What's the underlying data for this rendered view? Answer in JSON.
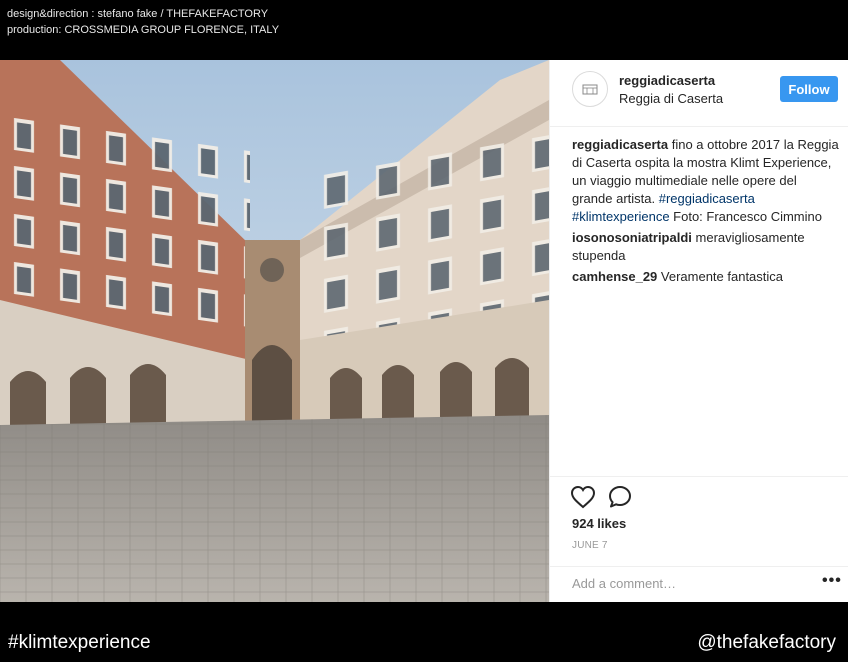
{
  "credits": {
    "line1": "design&direction : stefano fake / THEFAKEFACTORY",
    "line2": "production: CROSSMEDIA GROUP FLORENCE, ITALY"
  },
  "post": {
    "username": "reggiadicaserta",
    "location": "Reggia di Caserta",
    "follow_label": "Follow",
    "caption": {
      "user": "reggiadicaserta",
      "text": " fino a ottobre 2017 la Reggia di Caserta ospita la mostra Klimt Experience, un viaggio multimediale nelle opere del grande artista. ",
      "tag1": "#reggiadicaserta",
      "tag2": "#klimtexperience",
      "text2": " Foto: Francesco Cimmino"
    },
    "comments": [
      {
        "user": "iosonosoniatripaldi",
        "text": " meravigliosamente stupenda"
      },
      {
        "user": "camhense_29",
        "text": " Veramente fantastica"
      }
    ],
    "likes": "924 likes",
    "date": "JUNE 7",
    "add_comment_placeholder": "Add a comment…",
    "more_label": "•••"
  },
  "footer": {
    "left": "#klimtexperience",
    "right": "@thefakefactory"
  },
  "icons": {
    "avatar": "palace-logo-icon",
    "like": "heart-icon",
    "comment": "comment-bubble-icon",
    "more": "more-options-icon"
  },
  "colors": {
    "follow_button": "#3897f0",
    "hashtag": "#003569",
    "background": "#000000"
  }
}
